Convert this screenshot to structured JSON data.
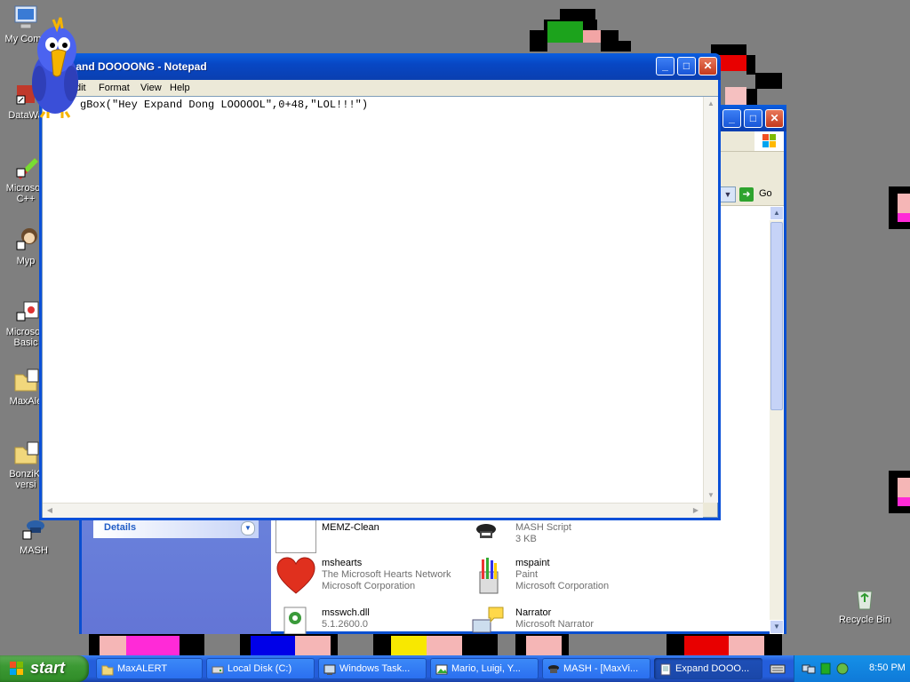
{
  "desktop": {
    "icons": [
      {
        "label": "My Comp"
      },
      {
        "label": "DataWa"
      },
      {
        "label": "Microsoft C++"
      },
      {
        "label": "Myp"
      },
      {
        "label": "Microsoft Basic"
      },
      {
        "label": "MaxAle"
      },
      {
        "label": "BonziKi versi"
      },
      {
        "label": "MASH"
      },
      {
        "label": "Recycle Bin"
      }
    ]
  },
  "explorer": {
    "go_label": "Go",
    "details_label": "Details",
    "items": [
      {
        "name": "MEMZ-Clean",
        "line1": "",
        "line2": ""
      },
      {
        "name": "MASH Script",
        "line1": "3 KB",
        "line2": ""
      },
      {
        "name": "mshearts",
        "line1": "The Microsoft Hearts Network",
        "line2": "Microsoft Corporation"
      },
      {
        "name": "mspaint",
        "line1": "Paint",
        "line2": "Microsoft Corporation"
      },
      {
        "name": "msswch.dll",
        "line1": "5.1.2600.0",
        "line2": ""
      },
      {
        "name": "Narrator",
        "line1": "Microsoft Narrator",
        "line2": ""
      }
    ]
  },
  "notepad": {
    "title": "Expand DOOOONG - Notepad",
    "title_visible": "pand DOOOONG - Notepad",
    "menu": [
      "Edit",
      "Format",
      "View",
      "Help"
    ],
    "menu_visible_edit": "dit",
    "content": "x=MsgBox(\"Hey Expand Dong LOOOOOL\",0+48,\"LOL!!!\")",
    "content_visible": "gBox(\"Hey Expand Dong LOOOOOL\",0+48,\"LOL!!!\")"
  },
  "taskbar": {
    "start_label": "start",
    "tasks": [
      {
        "label": "MaxALERT",
        "icon": "folder-icon"
      },
      {
        "label": "Local Disk (C:)",
        "icon": "drive-icon"
      },
      {
        "label": "Windows Task...",
        "icon": "task-manager-icon"
      },
      {
        "label": "Mario, Luigi, Y...",
        "icon": "image-icon"
      },
      {
        "label": "MASH - [MaxVi...",
        "icon": "mash-icon"
      },
      {
        "label": "Expand DOOO...",
        "icon": "notepad-icon"
      }
    ],
    "clock": "8:50 PM"
  },
  "colors": {
    "desktop_bg": "#7f7f7f",
    "title_blue": "#0a50d8",
    "taskbar_blue": "#245edb",
    "start_green": "#3c9a34"
  }
}
